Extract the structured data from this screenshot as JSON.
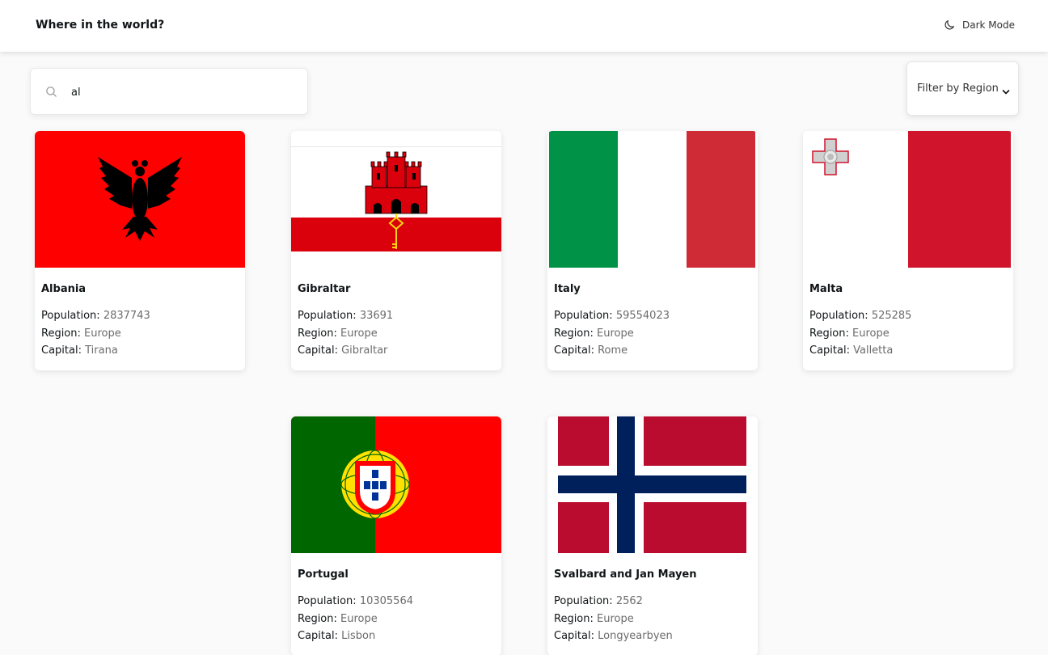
{
  "header": {
    "title": "Where in the world?",
    "theme_toggle_label": "Dark Mode"
  },
  "search": {
    "value": "al",
    "placeholder": "Search for a country..."
  },
  "filter": {
    "label": "Filter by Region"
  },
  "field_labels": {
    "population": "Population:",
    "region": "Region:",
    "capital": "Capital:"
  },
  "countries": [
    {
      "name": "Albania",
      "population": "2837743",
      "region": "Europe",
      "capital": "Tirana",
      "flag_icon": "albania-flag"
    },
    {
      "name": "Gibraltar",
      "population": "33691",
      "region": "Europe",
      "capital": "Gibraltar",
      "flag_icon": "gibraltar-flag"
    },
    {
      "name": "Italy",
      "population": "59554023",
      "region": "Europe",
      "capital": "Rome",
      "flag_icon": "italy-flag"
    },
    {
      "name": "Malta",
      "population": "525285",
      "region": "Europe",
      "capital": "Valletta",
      "flag_icon": "malta-flag"
    },
    {
      "name": "Portugal",
      "population": "10305564",
      "region": "Europe",
      "capital": "Lisbon",
      "flag_icon": "portugal-flag"
    },
    {
      "name": "Svalbard and Jan Mayen",
      "population": "2562",
      "region": "Europe",
      "capital": "Longyearbyen",
      "flag_icon": "norway-flag"
    }
  ],
  "colors": {
    "background": "#fafafa",
    "card": "#ffffff",
    "text": "#111517",
    "muted": "#6b6b6b"
  }
}
